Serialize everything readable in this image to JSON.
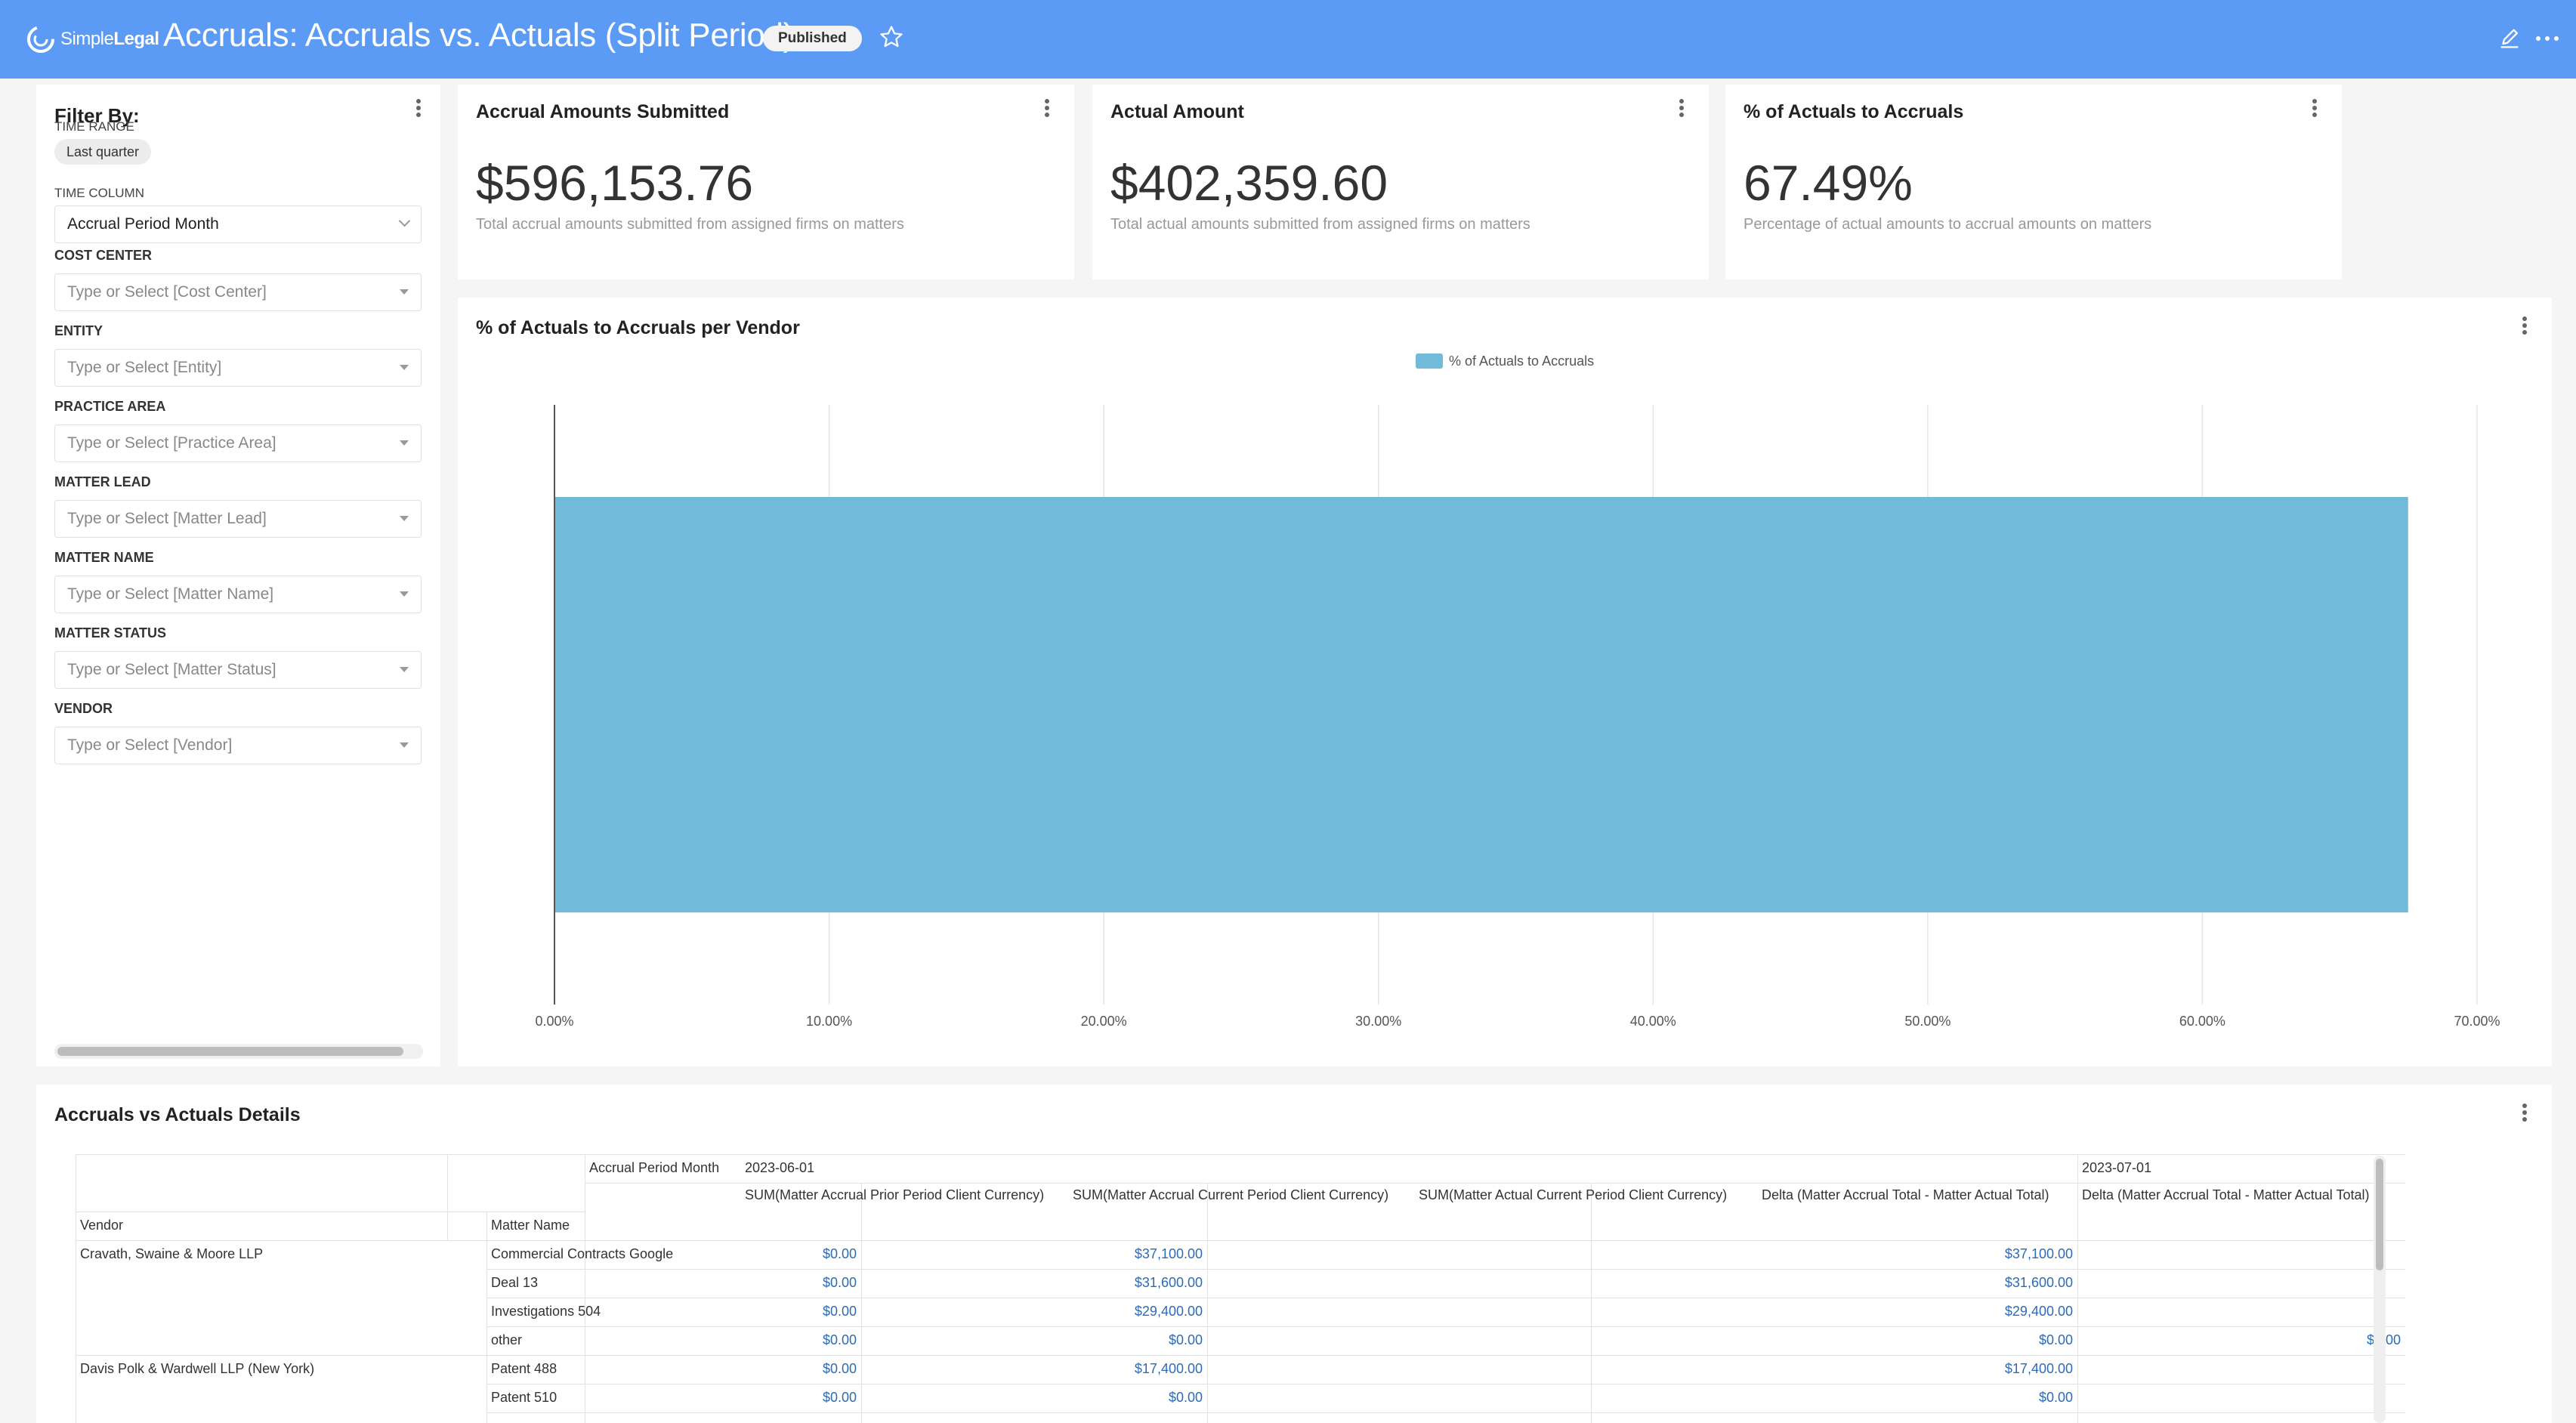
{
  "header": {
    "logo_light": "Simple",
    "logo_bold": "Legal",
    "title": "Accruals: Accruals vs. Actuals (Split Period)",
    "status_badge": "Published"
  },
  "filter": {
    "title": "Filter By:",
    "time_range_label": "TIME RANGE",
    "time_range_value": "Last quarter",
    "time_column_label": "TIME COLUMN",
    "time_column_value": "Accrual Period Month",
    "fields": [
      {
        "label": "COST CENTER",
        "placeholder": "Type or Select [Cost Center]"
      },
      {
        "label": "ENTITY",
        "placeholder": "Type or Select [Entity]"
      },
      {
        "label": "PRACTICE AREA",
        "placeholder": "Type or Select [Practice Area]"
      },
      {
        "label": "MATTER LEAD",
        "placeholder": "Type or Select [Matter Lead]"
      },
      {
        "label": "MATTER NAME",
        "placeholder": "Type or Select [Matter Name]"
      },
      {
        "label": "MATTER STATUS",
        "placeholder": "Type or Select [Matter Status]"
      },
      {
        "label": "VENDOR",
        "placeholder": "Type or Select [Vendor]"
      }
    ]
  },
  "kpis": [
    {
      "title": "Accrual Amounts Submitted",
      "value": "$596,153.76",
      "subtitle": "Total accrual amounts submitted from assigned firms on matters"
    },
    {
      "title": "Actual Amount",
      "value": "$402,359.60",
      "subtitle": "Total actual amounts submitted from assigned firms on matters"
    },
    {
      "title": "% of Actuals to Accruals",
      "value": "67.49%",
      "subtitle": "Percentage of actual amounts to accrual amounts on matters"
    }
  ],
  "chart_data": {
    "type": "bar",
    "orientation": "horizontal",
    "title": "% of Actuals to Accruals per Vendor",
    "legend_position": "top-center",
    "grid": true,
    "xlim": [
      0,
      70
    ],
    "x_ticks": [
      "0.00%",
      "10.00%",
      "20.00%",
      "30.00%",
      "40.00%",
      "50.00%",
      "60.00%",
      "70.00%"
    ],
    "x_tick_values": [
      0,
      10,
      20,
      30,
      40,
      50,
      60,
      70
    ],
    "categories": [
      ""
    ],
    "series": [
      {
        "name": "% of Actuals to Accruals",
        "values": [
          67.49
        ],
        "color": "#71bad9"
      }
    ]
  },
  "table": {
    "title": "Accruals vs Actuals Details",
    "pivot_label": "Accrual Period Month",
    "period_1": "2023-06-01",
    "period_2": "2023-07-01",
    "row_headers": [
      "Vendor",
      "Matter Name"
    ],
    "columns": [
      "SUM(Matter Accrual Prior Period Client Currency)",
      "SUM(Matter Accrual Current Period Client Currency)",
      "SUM(Matter Actual Current Period Client Currency)",
      "Delta (Matter Accrual Total - Matter Actual Total)",
      "Delta (Matter Accrual Total - Matter Actual Total)"
    ],
    "rows": [
      {
        "vendor": "Cravath, Swaine & Moore LLP",
        "matter": "Commercial Contracts Google",
        "c1": "$0.00",
        "c2": "$37,100.00",
        "c3": "",
        "c4": "$37,100.00",
        "c5": ""
      },
      {
        "vendor": "",
        "matter": "Deal 13",
        "c1": "$0.00",
        "c2": "$31,600.00",
        "c3": "",
        "c4": "$31,600.00",
        "c5": ""
      },
      {
        "vendor": "",
        "matter": "Investigations 504",
        "c1": "$0.00",
        "c2": "$29,400.00",
        "c3": "",
        "c4": "$29,400.00",
        "c5": ""
      },
      {
        "vendor": "",
        "matter": "other",
        "c1": "$0.00",
        "c2": "$0.00",
        "c3": "",
        "c4": "$0.00",
        "c5": "$0.00"
      },
      {
        "vendor": "Davis Polk & Wardwell LLP (New York)",
        "matter": "Patent 488",
        "c1": "$0.00",
        "c2": "$17,400.00",
        "c3": "",
        "c4": "$17,400.00",
        "c5": ""
      },
      {
        "vendor": "",
        "matter": "Patent 510",
        "c1": "$0.00",
        "c2": "$0.00",
        "c3": "",
        "c4": "$0.00",
        "c5": ""
      }
    ]
  }
}
